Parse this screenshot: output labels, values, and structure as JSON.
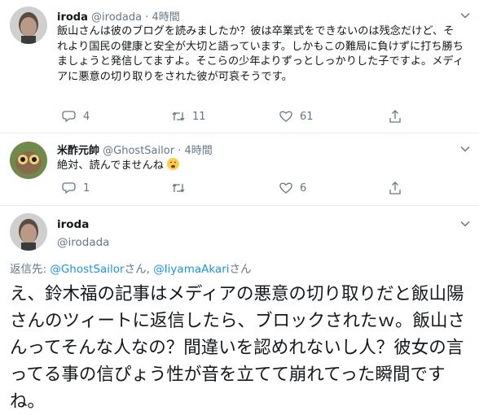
{
  "tweet1": {
    "name": "iroda",
    "handle": "@irodada",
    "dot": "·",
    "time": "4時間",
    "text": "飯山さんは彼のブログを読みましたか？彼は卒業式をできないのは残念だけど、それより国民の健康と安全が大切と語っています。しかもこの難局に負けずに打ち勝ちましょうと発信してますよ。そこらの少年よりずっとしっかりした子ですよ。メディアに悪意の切り取りをされた彼が可哀そうです。",
    "reply_count": "4",
    "retweet_count": "11",
    "like_count": "61"
  },
  "tweet2": {
    "name": "米酢元帥",
    "handle": "@GhostSailor",
    "dot": "·",
    "time": "4時間",
    "text": "絶対、読んでませんね",
    "emoji_icon": "weary-face-icon",
    "reply_count": "1",
    "retweet_count": "",
    "like_count": "6"
  },
  "main_tweet": {
    "name": "iroda",
    "handle": "@irodada",
    "reply_to_prefix": "返信先: ",
    "reply_to_user1": "@GhostSailor",
    "reply_to_sep": "さん, ",
    "reply_to_user2": "@IiyamaAkari",
    "reply_to_suffix": "さん",
    "text": "え、鈴木福の記事はメディアの悪意の切り取りだと飯山陽さんのツィートに返信したら、ブロックされたｗ。飯山さんってそんな人なの？間違いを認めれないし人？彼女の言ってる事の信ぴょう性が音を立てて崩れてった瞬間ですね。"
  },
  "colors": {
    "text": "#14171a",
    "secondary": "#657786",
    "link": "#1b95e0",
    "divider": "#e6ecf0"
  },
  "icons": [
    "reply-icon",
    "retweet-icon",
    "like-icon",
    "share-icon",
    "chevron-down-icon"
  ]
}
